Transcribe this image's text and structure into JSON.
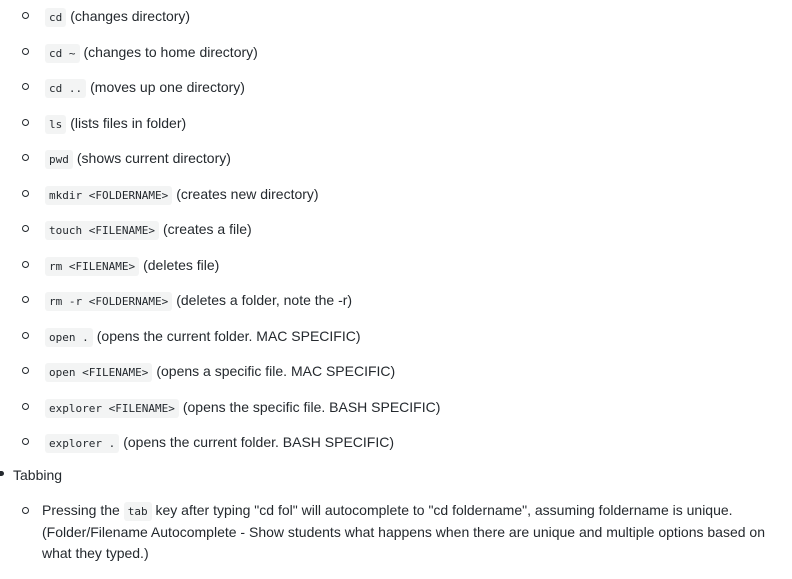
{
  "commands": [
    {
      "code": "cd",
      "desc": "(changes directory)"
    },
    {
      "code": "cd ~",
      "desc": "(changes to home directory)"
    },
    {
      "code": "cd ..",
      "desc": "(moves up one directory)"
    },
    {
      "code": "ls",
      "desc": "(lists files in folder)"
    },
    {
      "code": "pwd",
      "desc": "(shows current directory)"
    },
    {
      "code": "mkdir <FOLDERNAME>",
      "desc": "(creates new directory)"
    },
    {
      "code": "touch <FILENAME>",
      "desc": "(creates a file)"
    },
    {
      "code": "rm <FILENAME>",
      "desc": "(deletes file)"
    },
    {
      "code": "rm -r <FOLDERNAME>",
      "desc": "(deletes a folder, note the -r)"
    },
    {
      "code": "open .",
      "desc": "(opens the current folder. MAC SPECIFIC)"
    },
    {
      "code": "open <FILENAME>",
      "desc": "(opens a specific file. MAC SPECIFIC)"
    },
    {
      "code": "explorer <FILENAME>",
      "desc": "(opens the specific file. BASH SPECIFIC)"
    },
    {
      "code": "explorer .",
      "desc": "(opens the current folder. BASH SPECIFIC)"
    }
  ],
  "tabbing": {
    "label": "Tabbing",
    "item_prefix": "Pressing the",
    "item_code": "tab",
    "item_suffix": "key after typing \"cd fol\" will autocomplete to \"cd foldername\", assuming foldername is unique. (Folder/Filename Autocomplete - Show students what happens when there are unique and multiple options based on what they typed.)"
  }
}
